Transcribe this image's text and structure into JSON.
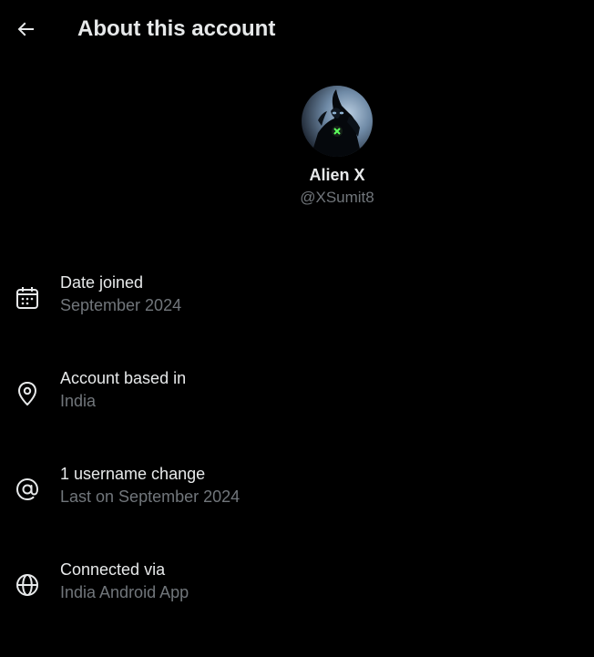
{
  "header": {
    "back_icon": "arrow-left-icon",
    "title": "About this account"
  },
  "profile": {
    "avatar_icon": "avatar-image",
    "display_name": "Alien X",
    "handle": "@XSumit8"
  },
  "details": [
    {
      "icon": "calendar-icon",
      "title": "Date joined",
      "subtitle": "September 2024"
    },
    {
      "icon": "location-pin-icon",
      "title": "Account based in",
      "subtitle": "India"
    },
    {
      "icon": "at-sign-icon",
      "title": "1 username change",
      "subtitle": "Last on September 2024"
    },
    {
      "icon": "globe-icon",
      "title": "Connected via",
      "subtitle": "India Android App"
    }
  ],
  "colors": {
    "background": "#000000",
    "primary_text": "#e7e9ea",
    "secondary_text": "#71767b"
  }
}
